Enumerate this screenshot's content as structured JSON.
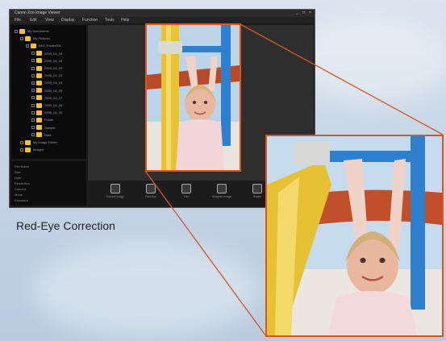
{
  "app": {
    "title": "Canon Zoo Image Viewer",
    "window_controls": [
      "_",
      "□",
      "×"
    ],
    "menu": [
      "File",
      "Edit",
      "View",
      "Display",
      "Function",
      "Tools",
      "Help"
    ]
  },
  "tree": {
    "items": [
      {
        "label": "My Documents",
        "level": 1
      },
      {
        "label": "My Pictures",
        "level": 2
      },
      {
        "label": "IMG_Folder001",
        "level": 3
      },
      {
        "label": "2009_04_16",
        "level": 4
      },
      {
        "label": "2009_04_18",
        "level": 4
      },
      {
        "label": "2009_04_20",
        "level": 4
      },
      {
        "label": "2009_04_22",
        "level": 4
      },
      {
        "label": "2009_04_24",
        "level": 4
      },
      {
        "label": "2009_04_25",
        "level": 4
      },
      {
        "label": "2009_04_27",
        "level": 4
      },
      {
        "label": "2009_04_28",
        "level": 4
      },
      {
        "label": "2009_04_30",
        "level": 4
      },
      {
        "label": "Folder",
        "level": 4
      },
      {
        "label": "Sample",
        "level": 4
      },
      {
        "label": "Data",
        "level": 4
      },
      {
        "label": "My Image Folder",
        "level": 2
      },
      {
        "label": "Images",
        "level": 2
      }
    ]
  },
  "properties": {
    "rows": [
      "File Name",
      "Size",
      "Date",
      "Resolution",
      "Camera",
      "Mode",
      "Exposure"
    ]
  },
  "toolbar": {
    "tools": [
      {
        "label": "Correct Image",
        "icon": "correct-icon"
      },
      {
        "label": "Red-Eye",
        "icon": "red-eye-icon"
      },
      {
        "label": "Trim",
        "icon": "trim-icon"
      },
      {
        "label": "Sharpen Image",
        "icon": "sharpen-icon"
      },
      {
        "label": "Rotate",
        "icon": "rotate-icon"
      }
    ]
  },
  "caption": "Red-Eye Correction",
  "colors": {
    "highlight_border": "#d9561f",
    "folder": "#f2c230"
  }
}
